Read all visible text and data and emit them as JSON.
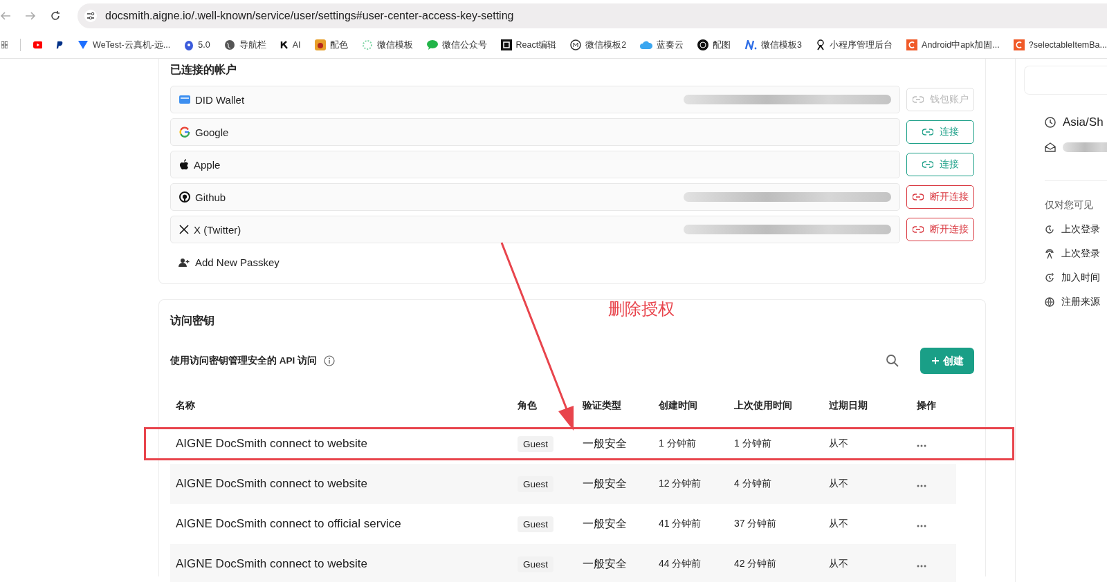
{
  "browser": {
    "url": "docsmith.aigne.io/.well-known/service/user/settings#user-center-access-key-setting",
    "bookmarks": [
      {
        "label": "WeTest-云真机-远..."
      },
      {
        "label": "5.0"
      },
      {
        "label": "导航栏"
      },
      {
        "label": "AI"
      },
      {
        "label": "配色"
      },
      {
        "label": "微信模板"
      },
      {
        "label": "微信公众号"
      },
      {
        "label": "React编辑"
      },
      {
        "label": "微信模板2"
      },
      {
        "label": "蓝奏云"
      },
      {
        "label": "配图"
      },
      {
        "label": "微信模板3"
      },
      {
        "label": "小程序管理后台"
      },
      {
        "label": "Android中apk加固..."
      },
      {
        "label": "?selectableItemBa..."
      }
    ]
  },
  "accounts": {
    "title": "已连接的帐户",
    "items": [
      {
        "name": "DID Wallet",
        "blurred": true,
        "action": {
          "label": "钱包账户",
          "kind": "wallet"
        }
      },
      {
        "name": "Google",
        "blurred": false,
        "action": {
          "label": "连接",
          "kind": "connect"
        }
      },
      {
        "name": "Apple",
        "blurred": false,
        "action": {
          "label": "连接",
          "kind": "connect"
        }
      },
      {
        "name": "Github",
        "blurred": true,
        "action": {
          "label": "断开连接",
          "kind": "disconnect"
        }
      },
      {
        "name": "X (Twitter)",
        "blurred": true,
        "action": {
          "label": "断开连接",
          "kind": "disconnect"
        }
      }
    ],
    "add_passkey": "Add New Passkey"
  },
  "access_keys": {
    "title": "访问密钥",
    "subtitle": "使用访问密钥管理安全的 API 访问",
    "create_label": "创建",
    "columns": [
      "名称",
      "角色",
      "验证类型",
      "创建时间",
      "上次使用时间",
      "过期日期",
      "操作"
    ],
    "rows": [
      {
        "name": "AIGNE DocSmith connect to website",
        "role": "Guest",
        "auth_type": "一般安全",
        "created": "1 分钟前",
        "last_used": "1 分钟前",
        "expires": "从不",
        "highlighted": true
      },
      {
        "name": "AIGNE DocSmith connect to website",
        "role": "Guest",
        "auth_type": "一般安全",
        "created": "12 分钟前",
        "last_used": "4 分钟前",
        "expires": "从不",
        "highlighted": false
      },
      {
        "name": "AIGNE DocSmith connect to official service",
        "role": "Guest",
        "auth_type": "一般安全",
        "created": "41 分钟前",
        "last_used": "37 分钟前",
        "expires": "从不",
        "highlighted": false
      },
      {
        "name": "AIGNE DocSmith connect to website",
        "role": "Guest",
        "auth_type": "一般安全",
        "created": "44 分钟前",
        "last_used": "42 分钟前",
        "expires": "从不",
        "highlighted": false
      }
    ]
  },
  "annotation": {
    "label": "删除授权"
  },
  "profile": {
    "timezone": "Asia/Sh",
    "email_blurred": true,
    "visible_title": "仅对您可见",
    "items": [
      "上次登录",
      "上次登录",
      "加入时间",
      "注册来源"
    ]
  }
}
